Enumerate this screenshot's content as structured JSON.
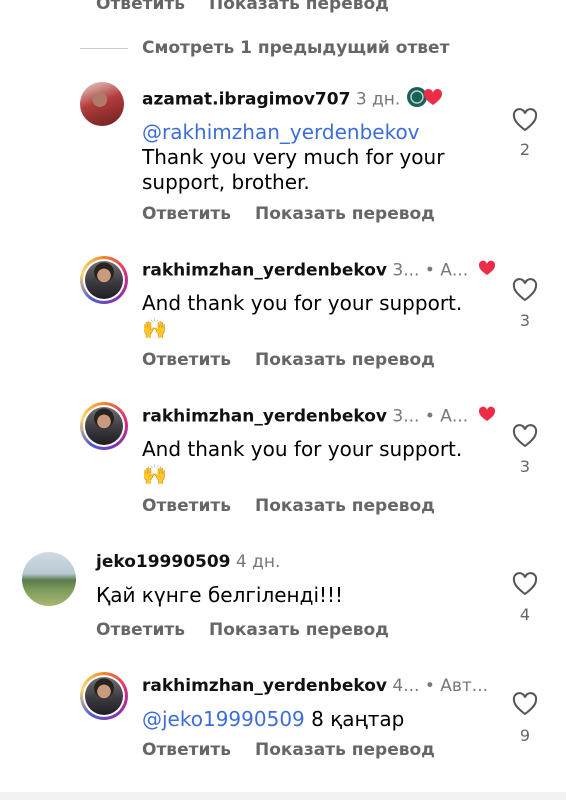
{
  "top_actions": {
    "reply": "Ответить",
    "translate": "Показать перевод"
  },
  "view_previous": "Смотреть 1 предыдущий ответ",
  "comments": [
    {
      "username": "azamat.ibragimov707",
      "time": "3 дн.",
      "mention": "@rakhimzhan_yerdenbekov",
      "text": "Thank you very much for your support, brother.",
      "reply": "Ответить",
      "translate": "Показать перевод",
      "likes": "2"
    },
    {
      "username": "rakhimzhan_yerdenbekov",
      "time": "3...",
      "author_label": "• А...",
      "text": "And thank you for your support.",
      "emoji": "🙌",
      "reply": "Ответить",
      "translate": "Показать перевод",
      "likes": "3"
    },
    {
      "username": "rakhimzhan_yerdenbekov",
      "time": "3...",
      "author_label": "• А...",
      "text": "And thank you for your support.",
      "emoji": "🙌",
      "reply": "Ответить",
      "translate": "Показать перевод",
      "likes": "3"
    },
    {
      "username": "jeko19990509",
      "time": "4 дн.",
      "text": "Қай күнге белгіленді!!!",
      "reply": "Ответить",
      "translate": "Показать перевод",
      "likes": "4"
    },
    {
      "username": "rakhimzhan_yerdenbekov",
      "time": "4...",
      "author_label": "• Авт...",
      "mention": "@jeko19990509",
      "text": "8 қаңтар",
      "reply": "Ответить",
      "translate": "Показать перевод",
      "likes": "9"
    }
  ],
  "colors": {
    "mention": "#3d6ed8",
    "heart": "#ed2c48"
  }
}
